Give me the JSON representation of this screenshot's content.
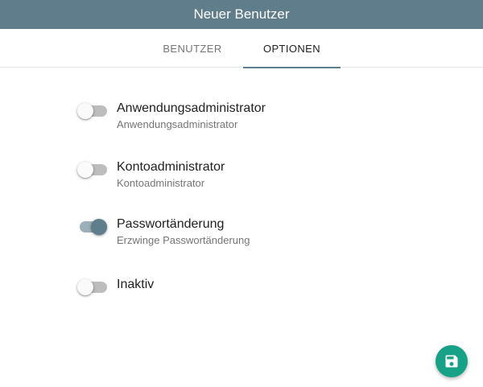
{
  "dialog": {
    "title": "Neuer Benutzer"
  },
  "tabs": [
    {
      "label": "BENUTZER",
      "active": false
    },
    {
      "label": "OPTIONEN",
      "active": true
    }
  ],
  "options": [
    {
      "title": "Anwendungsadministrator",
      "subtitle": "Anwendungsadministrator",
      "checked": false
    },
    {
      "title": "Kontoadministrator",
      "subtitle": "Kontoadministrator",
      "checked": false
    },
    {
      "title": "Passwortänderung",
      "subtitle": "Erzwinge Passwortänderung",
      "checked": true
    },
    {
      "title": "Inaktiv",
      "subtitle": "",
      "checked": false
    }
  ],
  "save_button": {
    "icon": "floppy-disk-icon"
  },
  "colors": {
    "primary": "#5f7d8b",
    "accent": "#17a287",
    "switch_off_track": "#bdbdbd",
    "switch_on_track": "#9cb0ba"
  }
}
